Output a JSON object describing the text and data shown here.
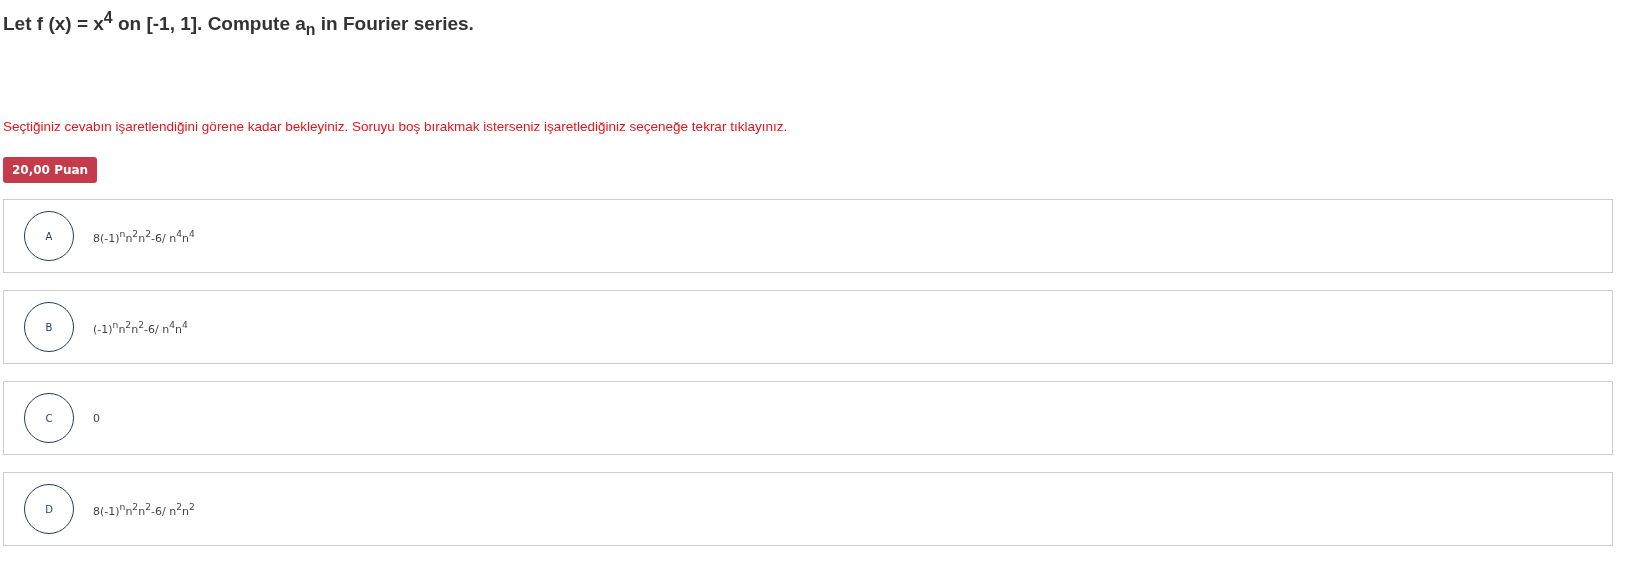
{
  "question": {
    "text": "Let f (x) = x$^{4}$ on [-1, 1]. Compute a$_{n}$ in Fourier series."
  },
  "notice": "Seçtiğiniz cevabın işaretlendiğini görene kadar bekleyiniz. Soruyu boş bırakmak isterseniz işaretlediğiniz seçeneğe tekrar tıklayınız.",
  "points_badge": "20,00 Puan",
  "options": [
    {
      "letter": "A",
      "text": "8(-1)$^{n}$n$^{2}$n$^{2}$-6/ n$^{4}$n$^{4}$"
    },
    {
      "letter": "B",
      "text": "(-1)$^{n}$n$^{2}$n$^{2}$-6/ n$^{4}$n$^{4}$"
    },
    {
      "letter": "C",
      "text": "0"
    },
    {
      "letter": "D",
      "text": "8(-1)$^{n}$n$^{2}$n$^{2}$-6/ n$^{2}$n$^{2}$"
    }
  ]
}
